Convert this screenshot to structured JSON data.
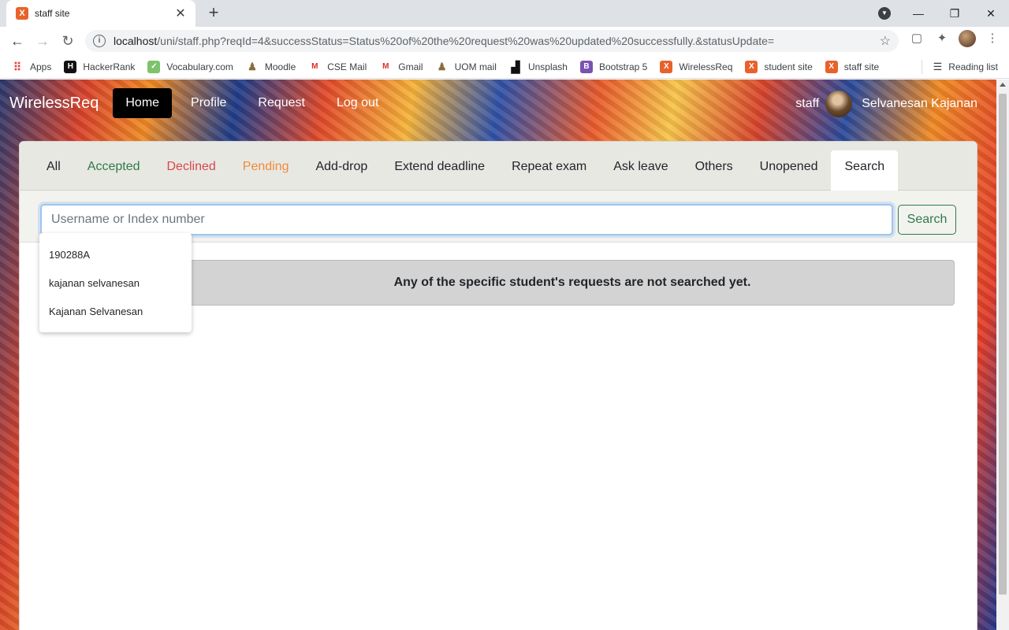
{
  "browser": {
    "tab_title": "staff site",
    "tab_favicon": "X",
    "url_host": "localhost",
    "url_path": "/uni/staff.php?reqId=4&successStatus=Status%20of%20the%20request%20was%20updated%20successfully.&statusUpdate=",
    "bookmarks": [
      {
        "label": "Apps",
        "icon": "apps-grid-icon",
        "color": "#ea4335",
        "glyph": "⠿"
      },
      {
        "label": "HackerRank",
        "icon": "hackerrank-icon",
        "color": "#1ba94c",
        "glyph": "H"
      },
      {
        "label": "Vocabulary.com",
        "icon": "vocabulary-icon",
        "color": "#7dc36b",
        "glyph": "✓"
      },
      {
        "label": "Moodle",
        "icon": "moodle-icon",
        "color": "#8a6d3b",
        "glyph": "♟"
      },
      {
        "label": "CSE Mail",
        "icon": "gmail-icon",
        "color": "#d93025",
        "glyph": "M"
      },
      {
        "label": "Gmail",
        "icon": "gmail-icon",
        "color": "#d93025",
        "glyph": "M"
      },
      {
        "label": "UOM mail",
        "icon": "uom-icon",
        "color": "#8a6d3b",
        "glyph": "♟"
      },
      {
        "label": "Unsplash",
        "icon": "unsplash-icon",
        "color": "#111111",
        "glyph": "▟"
      },
      {
        "label": "Bootstrap 5",
        "icon": "bootstrap-icon",
        "color": "#7952b3",
        "glyph": "B"
      },
      {
        "label": "WirelessReq",
        "icon": "xampp-icon",
        "color": "#e8622b",
        "glyph": "X"
      },
      {
        "label": "student site",
        "icon": "xampp-icon",
        "color": "#e8622b",
        "glyph": "X"
      },
      {
        "label": "staff site",
        "icon": "xampp-icon",
        "color": "#e8622b",
        "glyph": "X"
      }
    ],
    "reading_list": "Reading list"
  },
  "navbar": {
    "brand": "WirelessReq",
    "links": [
      {
        "label": "Home"
      },
      {
        "label": "Profile"
      },
      {
        "label": "Request"
      },
      {
        "label": "Log out"
      }
    ],
    "user_role": "staff",
    "user_name": "Selvanesan Kajanan"
  },
  "filter_tabs": [
    {
      "label": "All"
    },
    {
      "label": "Accepted"
    },
    {
      "label": "Declined"
    },
    {
      "label": "Pending"
    },
    {
      "label": "Add-drop"
    },
    {
      "label": "Extend deadline"
    },
    {
      "label": "Repeat exam"
    },
    {
      "label": "Ask leave"
    },
    {
      "label": "Others"
    },
    {
      "label": "Unopened"
    },
    {
      "label": "Search"
    }
  ],
  "search": {
    "placeholder": "Username or Index number",
    "value": "",
    "button_label": "Search",
    "suggestions": [
      "190288A",
      "kajanan selvanesan",
      "Kajanan Selvanesan"
    ]
  },
  "empty_message": "Any of the specific student's requests are not searched yet.",
  "colors": {
    "accepted": "#2f7a4a",
    "declined": "#d9474a",
    "pending": "#f08a3c",
    "active_nav": "#000000"
  }
}
